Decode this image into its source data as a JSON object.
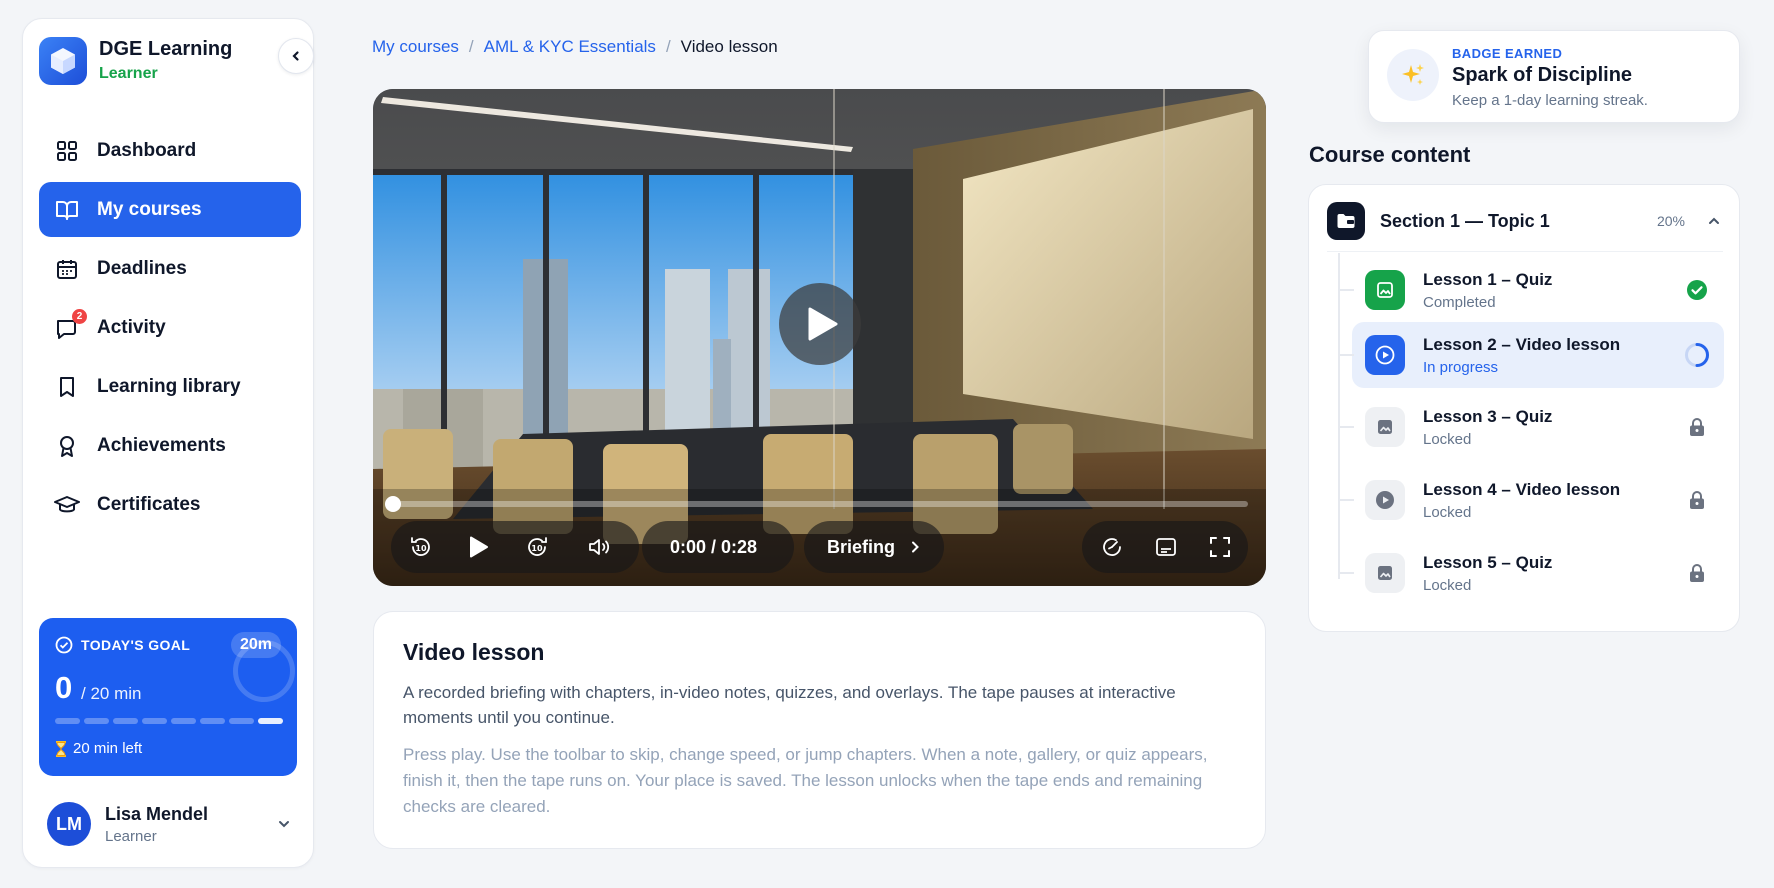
{
  "app": {
    "name": "DGE Learning",
    "role": "Learner"
  },
  "nav": [
    {
      "label": "Dashboard",
      "icon": "grid-icon",
      "active": false
    },
    {
      "label": "My courses",
      "icon": "book-icon",
      "active": true
    },
    {
      "label": "Deadlines",
      "icon": "calendar-icon",
      "active": false
    },
    {
      "label": "Activity",
      "icon": "chat-icon",
      "active": false,
      "badge": "2"
    },
    {
      "label": "Learning library",
      "icon": "bookmark-icon",
      "active": false
    },
    {
      "label": "Achievements",
      "icon": "award-icon",
      "active": false
    },
    {
      "label": "Certificates",
      "icon": "graduation-cap-icon",
      "active": false
    }
  ],
  "goal": {
    "heading": "TODAY'S GOAL",
    "chip": "20m",
    "value": "0",
    "of": "/ 20 min",
    "left": "20 min left",
    "segments": 8
  },
  "user": {
    "initials": "LM",
    "name": "Lisa Mendel",
    "role": "Learner"
  },
  "breadcrumb": {
    "first": "My courses",
    "second": "AML & KYC Essentials",
    "current": "Video lesson",
    "separator": "/"
  },
  "video": {
    "time": "0:00 / 0:28",
    "chapter": "Briefing",
    "progress": 0
  },
  "description": {
    "title": "Video lesson",
    "summary": "A recorded briefing with chapters, in-video notes, quizzes, and overlays. The tape pauses at interactive moments until you continue.",
    "instructions": "Press play. Use the toolbar to skip, change speed, or jump chapters. When a note, gallery, or quiz appears, finish it, then the tape runs on. Your place is saved. The lesson unlocks when the tape ends and remaining checks are cleared."
  },
  "badge": {
    "kicker": "BADGE EARNED",
    "title": "Spark of Discipline",
    "subtitle": "Keep a 1-day learning streak.",
    "icon": "sparkles-icon"
  },
  "course_content": {
    "title": "Course content",
    "section": {
      "title": "Section 1 — Topic 1",
      "percent": "20%"
    },
    "lessons": [
      {
        "title": "Lesson 1 – Quiz",
        "status": "Completed",
        "state": "completed",
        "kind": "quiz"
      },
      {
        "title": "Lesson 2 – Video lesson",
        "status": "In progress",
        "state": "in-progress",
        "kind": "video"
      },
      {
        "title": "Lesson 3 – Quiz",
        "status": "Locked",
        "state": "locked",
        "kind": "quiz"
      },
      {
        "title": "Lesson 4 – Video lesson",
        "status": "Locked",
        "state": "locked",
        "kind": "video"
      },
      {
        "title": "Lesson 5 – Quiz",
        "status": "Locked",
        "state": "locked",
        "kind": "quiz"
      }
    ]
  },
  "colors": {
    "primary": "#2563eb",
    "success": "#16a34a",
    "ink": "#0f172a"
  }
}
